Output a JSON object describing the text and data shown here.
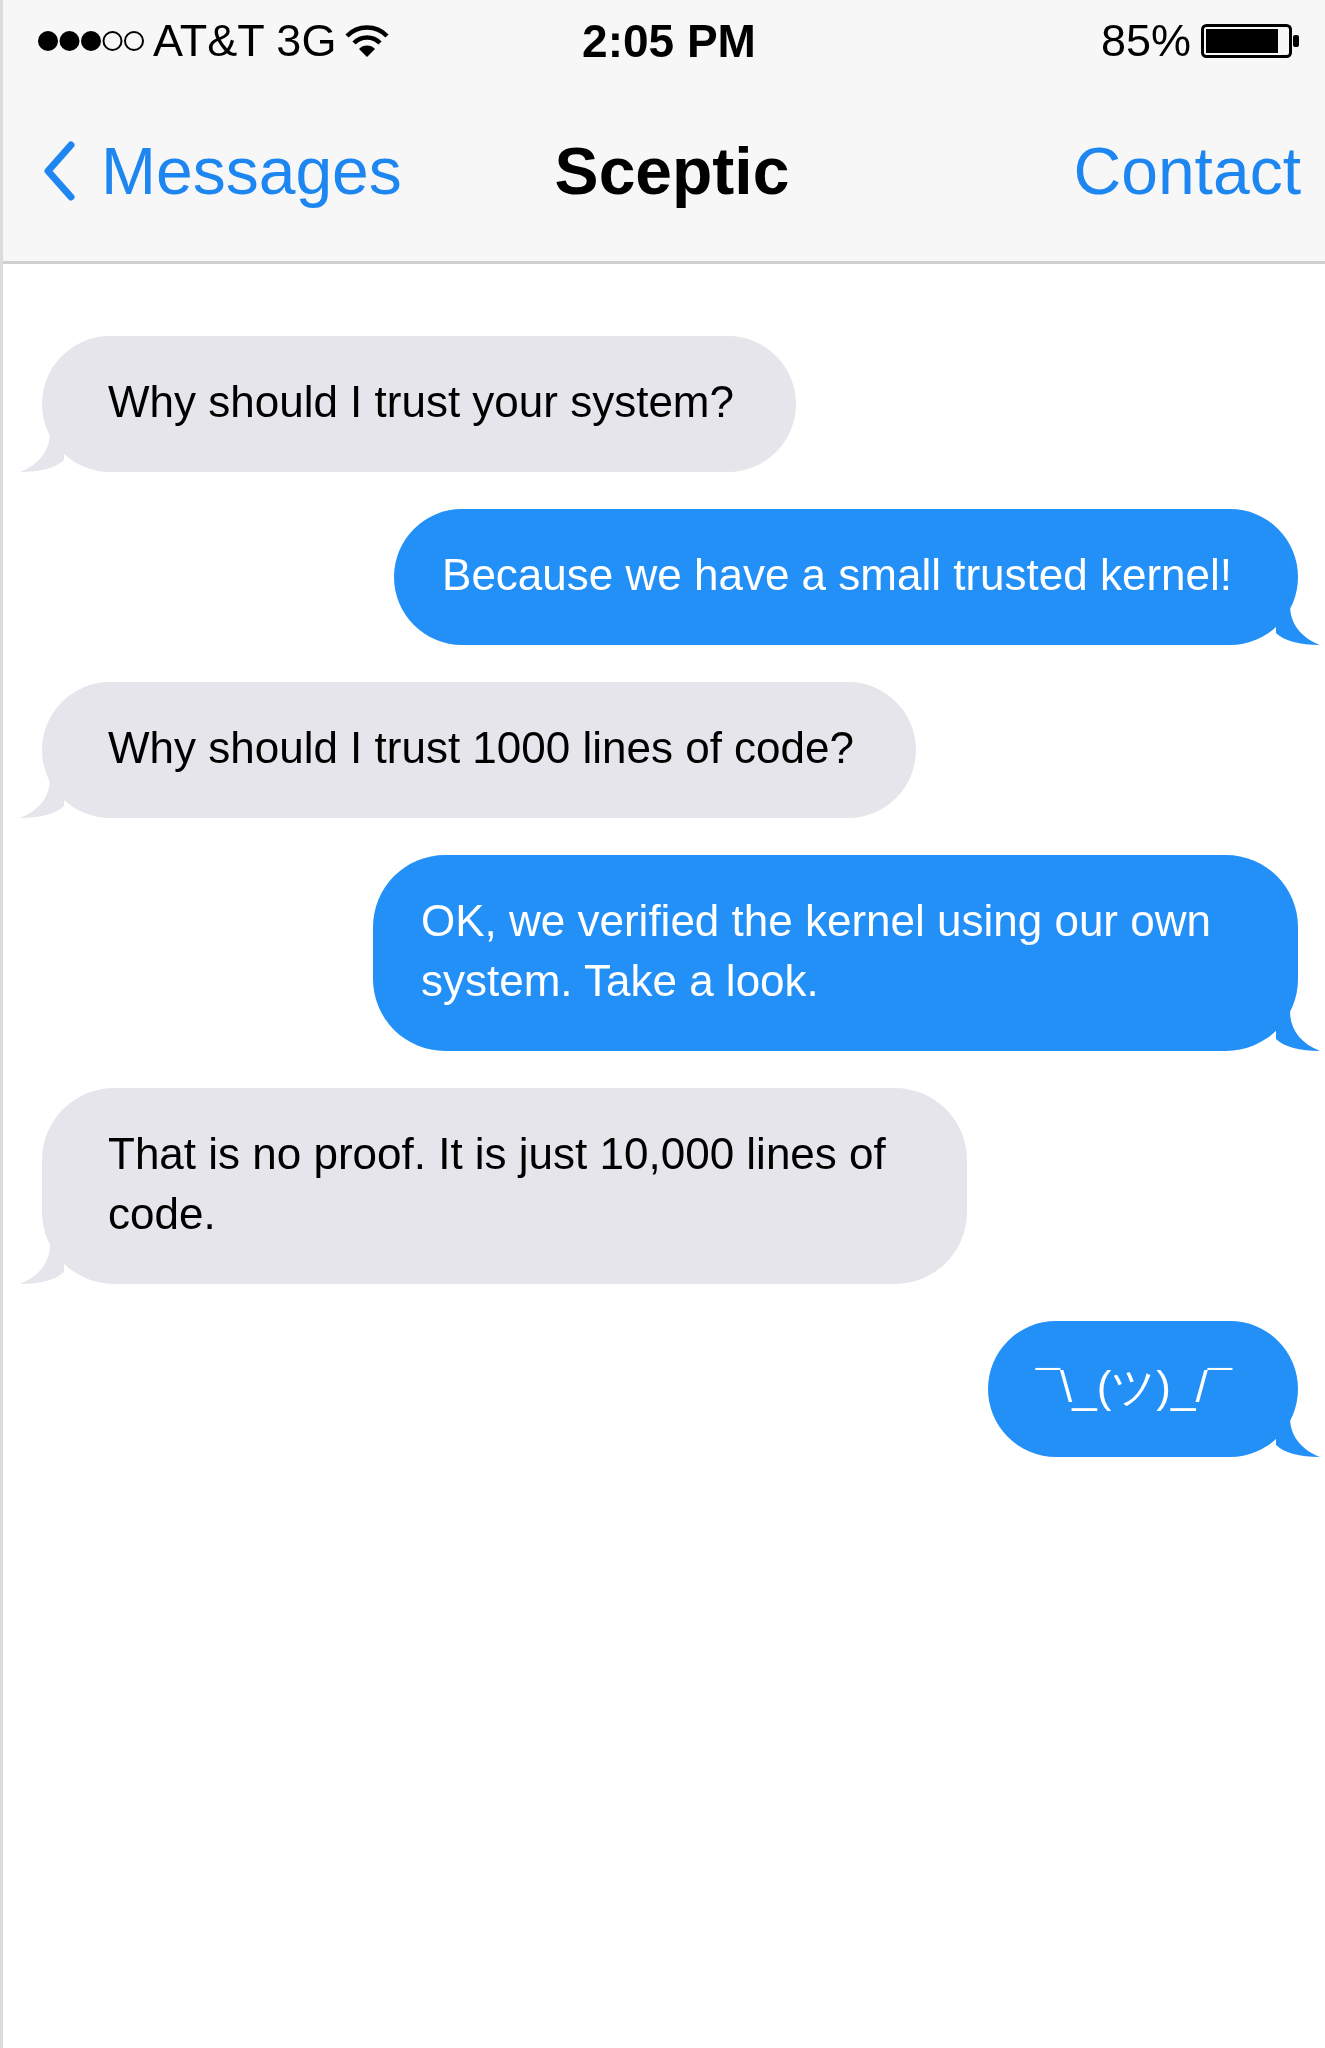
{
  "status_bar": {
    "carrier": "AT&T 3G",
    "time": "2:05 PM",
    "battery": "85%"
  },
  "nav_bar": {
    "back": "Messages",
    "title": "Sceptic",
    "action": "Contact"
  },
  "messages": [
    {
      "kind": "incoming",
      "text": "Why should I trust your system?"
    },
    {
      "kind": "outgoing",
      "text": "Because we have a small trusted kernel!"
    },
    {
      "kind": "incoming",
      "text": "Why should I trust 1000 lines of code?"
    },
    {
      "kind": "outgoing",
      "text": "OK, we verified the kernel using our own system. Take a look."
    },
    {
      "kind": "incoming",
      "text": "That is no proof. It is just 10,000 lines of code."
    },
    {
      "kind": "outgoing",
      "text": "¯\\_(ツ)_/¯"
    }
  ]
}
